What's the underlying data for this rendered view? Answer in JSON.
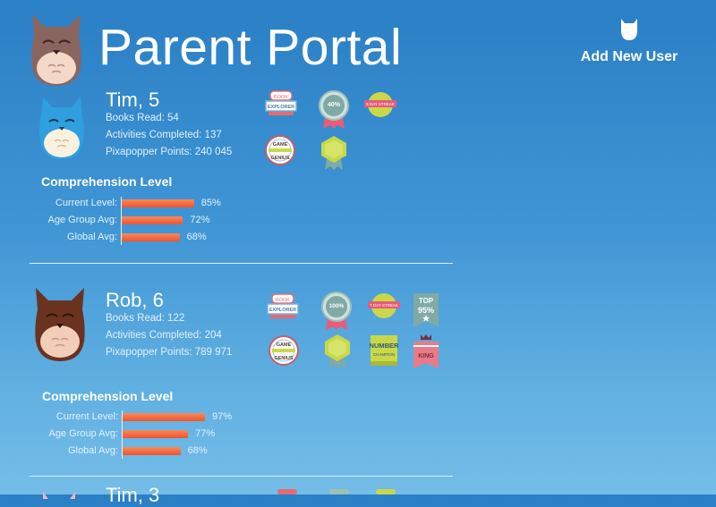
{
  "header": {
    "title": "Parent Portal",
    "add_user_label": "Add New User"
  },
  "labels": {
    "comprehension_title": "Comprehension Level",
    "current_level": "Current Level:",
    "age_group_avg": "Age Group Avg:",
    "global_avg": "Global Avg:"
  },
  "children": [
    {
      "name": "Tim, 5",
      "books_read": "Books Read: 54",
      "activities": "Activities Completed: 137",
      "points": "Pixapopper Points: 240 045",
      "current_pct": "85%",
      "age_pct": "72%",
      "global_pct": "68%",
      "current_value": 85,
      "age_value": 72,
      "global_value": 68,
      "badges": [
        {
          "line1": "BOOK",
          "line2": "EXPLORER"
        },
        {
          "line1": "40%"
        },
        {
          "line1": "5 DAY STREAK"
        },
        {
          "line1": "GAME",
          "line2": "GENIUS"
        },
        {
          "line1": ""
        }
      ]
    },
    {
      "name": "Rob, 6",
      "books_read": "Books Read: 122",
      "activities": "Activities Completed: 204",
      "points": "Pixapopper Points: 789 971",
      "current_pct": "97%",
      "age_pct": "77%",
      "global_pct": "68%",
      "current_value": 97,
      "age_value": 77,
      "global_value": 68,
      "badges": [
        {
          "line1": "BOOK",
          "line2": "EXPLORER"
        },
        {
          "line1": "100%"
        },
        {
          "line1": "7 DAY STREAK"
        },
        {
          "line1": "TOP",
          "line2": "95%"
        },
        {
          "line1": "GAME",
          "line2": "GENIUS"
        },
        {
          "line1": ""
        },
        {
          "line1": "NUMBER",
          "line2": "CHAMPION"
        },
        {
          "line1": "KING"
        }
      ]
    },
    {
      "name": "Tim, 3"
    }
  ],
  "colors": {
    "bar": "#ef5430",
    "bird_blue": "#2f9fe0",
    "owl_brown": "#6a3320",
    "owl_rose": "#8a6560"
  }
}
